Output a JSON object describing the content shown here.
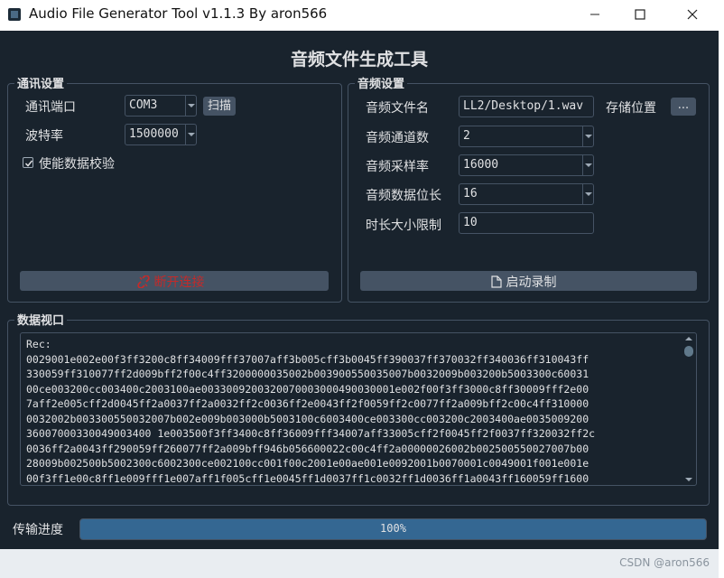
{
  "window": {
    "title": "Audio File Generator Tool v1.1.3 By aron566"
  },
  "main_title": "音频文件生成工具",
  "comm": {
    "title": "通讯设置",
    "port_label": "通讯端口",
    "port_value": "COM3",
    "scan_label": "扫描",
    "baud_label": "波特率",
    "baud_value": "1500000",
    "checksum_label": "使能数据校验",
    "checksum_checked": true,
    "disconnect_label": "断开连接",
    "disconnect_color": "#c32a2a"
  },
  "audio": {
    "title": "音频设置",
    "filename_label": "音频文件名",
    "filename_value": "LL2/Desktop/1.wav",
    "save_location_label": "存储位置",
    "browse_label": "...",
    "channels_label": "音频通道数",
    "channels_value": "2",
    "sample_rate_label": "音频采样率",
    "sample_rate_value": "16000",
    "bit_depth_label": "音频数据位长",
    "bit_depth_value": "16",
    "duration_label": "时长大小限制",
    "duration_value": "10",
    "record_label": "启动录制"
  },
  "data_view": {
    "title": "数据视口",
    "lines": [
      "Rec:",
      "0029001e002e00f3ff3200c8ff34009fff37007aff3b005cff3b0045ff390037ff370032ff340036ff310043ff",
      "330059ff310077ff2d009bff2f00c4ff3200000035002b003900550035007b0032009b003200b5003300c60031",
      "00ce003200cc003400c2003100ae0033009200320070003000490030001e002f00f3ff3000c8ff30009fff2e00",
      "7aff2e005cff2d0045ff2a0037ff2a0032ff2c0036ff2e0043ff2f0059ff2c0077ff2a009bff2c00c4ff310000",
      "0032002b003300550032007b002e009b003000b5003100c6003400ce003300cc003200c2003400ae0035009200",
      "36007000330049003400 1e003500f3ff3400c8ff36009fff34007aff33005cff2f0045ff2f0037ff320032ff2c",
      "0036ff2a0043ff290059ff260077ff2a009bff946b056600022c00c4ff2a00000026002b002500550027007b00",
      "28009b002500b5002300c6002300ce002100cc001f00c2001e00ae001e0092001b0070001c0049001f001e001e",
      "00f3ff1e00c8ff1e009fff1e007aff1f005cff1e0045ff1d0037ff1c0032ff1d0036ff1a0043ff160059ff1600"
    ]
  },
  "progress": {
    "label": "传输进度",
    "value_percent": 100,
    "text": "100%"
  },
  "footer": {
    "watermark": "CSDN @aron566"
  }
}
